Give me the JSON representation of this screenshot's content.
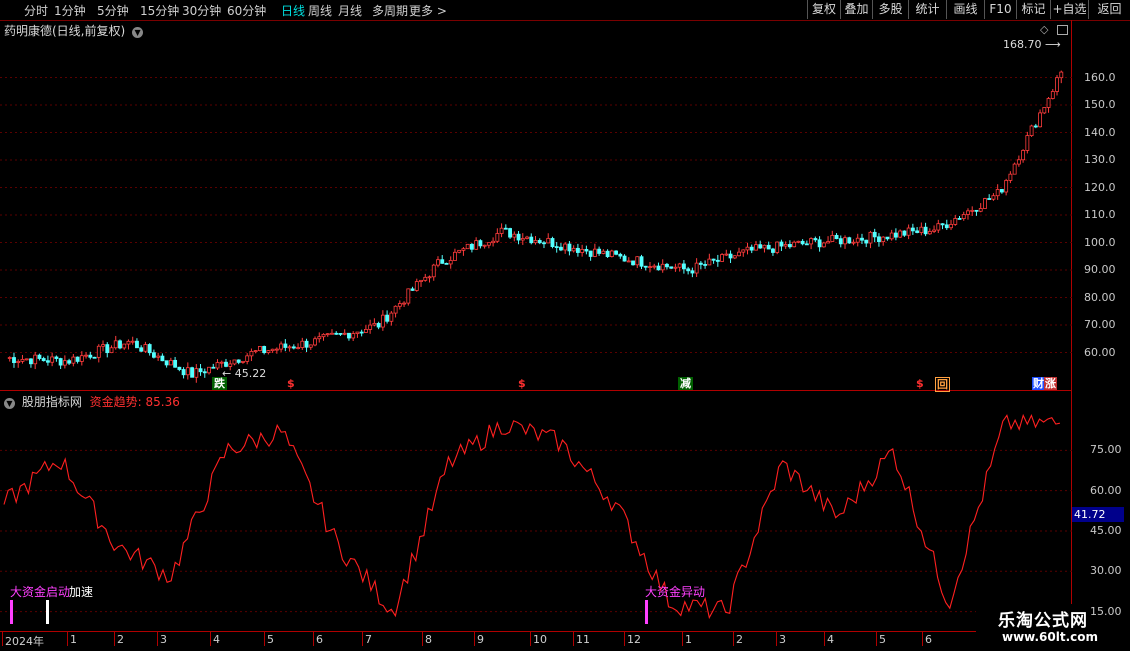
{
  "toolbar": {
    "periods": [
      "分时",
      "1分钟",
      "5分钟",
      "15分钟",
      "30分钟",
      "60分钟",
      "日线",
      "周线",
      "月线",
      "多周期",
      "更多 >"
    ],
    "active_period": "日线",
    "right_buttons": [
      "复权",
      "叠加",
      "多股",
      "统计",
      "画线",
      "F10",
      "标记",
      "+自选",
      "返回"
    ]
  },
  "main_panel": {
    "title": "药明康德(日线,前复权)",
    "y_ticks": [
      "160.0",
      "150.0",
      "140.0",
      "130.0",
      "120.0",
      "110.0",
      "100.0",
      "90.00",
      "80.00",
      "70.00",
      "60.00"
    ],
    "high_label": "168.70",
    "low_label": "45.22",
    "markers": [
      "跌",
      "$",
      "$",
      "减",
      "$",
      "回",
      "财",
      "涨"
    ]
  },
  "indicator_panel": {
    "title": "股朋指标网",
    "series_label": "资金趋势: 85.36",
    "current_value": "41.72",
    "y_ticks": [
      "75.00",
      "60.00",
      "45.00",
      "30.00",
      "15.00"
    ],
    "signals": [
      "大资金启动",
      "加速",
      "大资金异动"
    ]
  },
  "time_axis": [
    "2024年",
    "1",
    "2",
    "3",
    "4",
    "5",
    "6",
    "7",
    "8",
    "9",
    "10",
    "11",
    "12",
    "1",
    "2",
    "3",
    "4",
    "5",
    "6"
  ],
  "watermark": {
    "name": "乐淘公式网",
    "url": "www.60lt.com"
  },
  "colors": {
    "up": "#ff3c3c",
    "down": "#54ffff",
    "line": "#ff2020",
    "signal": "#ff40ff",
    "grid": "#5a0000",
    "active": "#00e0e0"
  },
  "chart_data": [
    {
      "type": "line",
      "series": [
        {
          "name": "",
          "values": []
        }
      ],
      "x": [
        "2024-01",
        "2024-02",
        "2024-03",
        "2024-04",
        "2024-05",
        "2024-06",
        "2024-07",
        "2024-08",
        "2024-09",
        "2024-10",
        "2024-11",
        "2024-12",
        "2025-01",
        "2025-02",
        "2025-03",
        "2025-04",
        "2025-05",
        "2025-06"
      ],
      "close": [
        58,
        57,
        64,
        52,
        60,
        64,
        70,
        93,
        104,
        99,
        94,
        90,
        97,
        100,
        102,
        105,
        118,
        162
      ],
      "ylim": [
        50,
        170
      ]
    },
    {
      "type": "line",
      "series": [
        {
          "name": "资金趋势",
          "values": [
            55,
            72,
            40,
            28,
            75,
            82,
            40,
            15,
            70,
            85,
            78,
            55,
            18,
            15,
            70,
            50,
            75,
            18,
            85,
            85
          ]
        }
      ],
      "ylim": [
        10,
        90
      ]
    }
  ]
}
